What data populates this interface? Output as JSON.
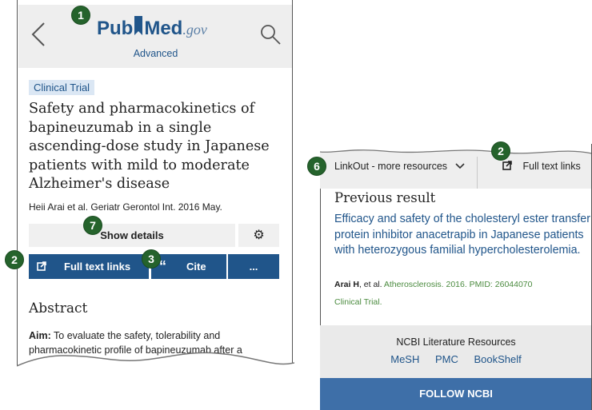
{
  "left_panel": {
    "header": {
      "logo_pub": "Pub",
      "logo_med": "Med",
      "logo_gov": ".gov",
      "advanced": "Advanced"
    },
    "tag": "Clinical Trial",
    "title": "Safety and pharmacokinetics of bapineuzumab in a single ascending-dose study in Japanese patients with mild to moderate Alzheimer's disease",
    "authors": "Heii Arai et al. Geriatr Gerontol Int. 2016 May.",
    "show_details": "Show details",
    "full_text_links": "Full text links",
    "cite": "Cite",
    "more": "...",
    "abstract_heading": "Abstract",
    "abstract_label": "Aim:",
    "abstract_text": " To evaluate the safety, tolerability and pharmacokinetic profile of bapineuzumab after a"
  },
  "right_panel": {
    "linkout": "LinkOut - more resources",
    "full_text_links": "Full text links",
    "prev_heading": "Previous result",
    "prev_title": "Efficacy and safety of the cholesteryl ester transfer protein inhibitor anacetrapib in Japanese patients with heterozygous familial hypercholesterolemia.",
    "prev_author": "Arai H",
    "prev_etal": ", et al. ",
    "prev_journal": "Atherosclerosis. 2016. PMID: 26044070",
    "prev_type": "Clinical Trial.",
    "ncbi_title": "NCBI Literature Resources",
    "ncbi_links": [
      "MeSH",
      "PMC",
      "BookShelf"
    ],
    "follow": "FOLLOW NCBI"
  },
  "markers": [
    "1",
    "2",
    "3",
    "2",
    "6",
    "7"
  ],
  "colors": {
    "brand": "#20558a",
    "marker": "#25632c",
    "follow_bar": "#3e6fa8",
    "clinical_trial": "#4b8b3f"
  }
}
